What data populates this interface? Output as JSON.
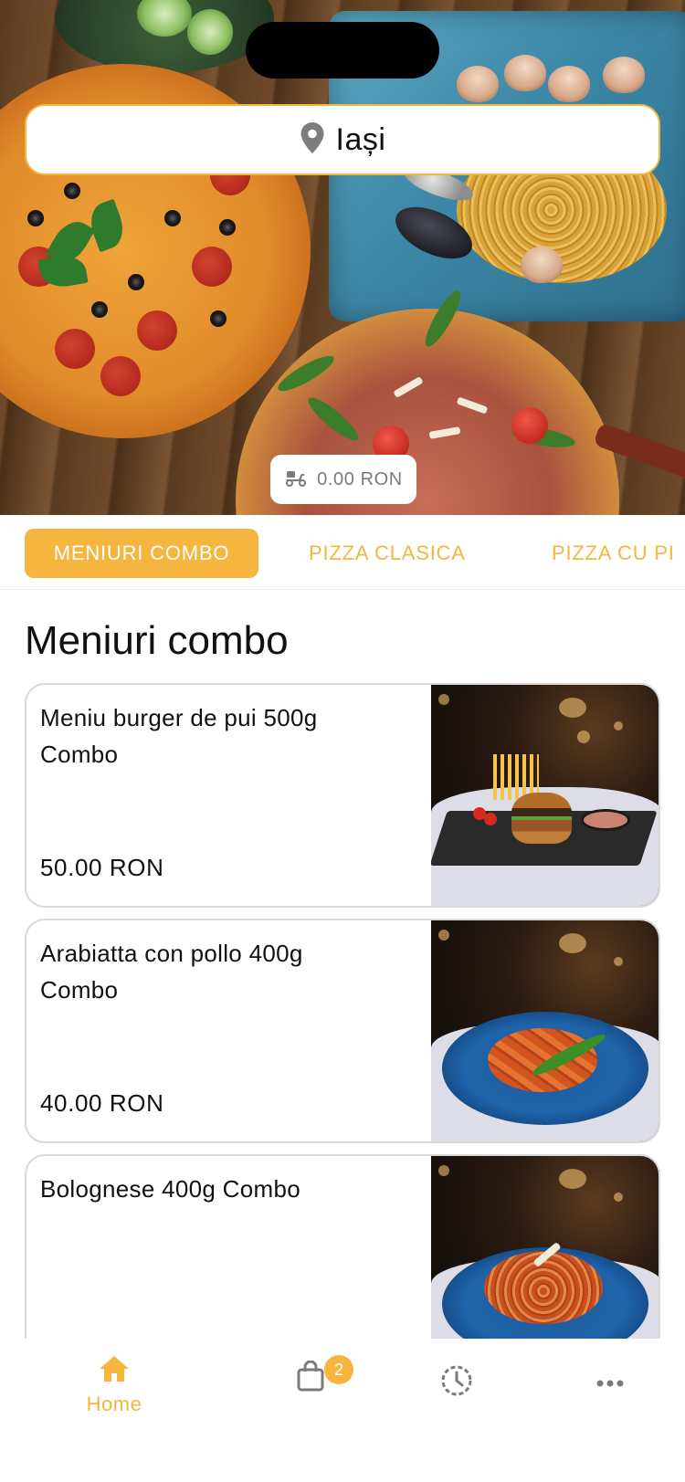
{
  "header": {
    "location": "Iași",
    "delivery_fee": "0.00 RON"
  },
  "categories": [
    {
      "label": "MENIURI COMBO",
      "active": true
    },
    {
      "label": "PIZZA CLASICA",
      "active": false
    },
    {
      "label": "PIZZA CU PI",
      "active": false
    }
  ],
  "section": {
    "title": "Meniuri combo"
  },
  "products": [
    {
      "name": "Meniu burger de pui 500g Combo",
      "price": "50.00 RON"
    },
    {
      "name": "Arabiatta con pollo 400g Combo",
      "price": "40.00 RON"
    },
    {
      "name": "Bolognese 400g Combo",
      "price": ""
    }
  ],
  "bottom_nav": {
    "home_label": "Home",
    "cart_count": "2"
  },
  "colors": {
    "accent": "#f6b53e",
    "text": "#111111",
    "muted": "#7a7a7a",
    "border": "#d9d9d9"
  },
  "icons": [
    "location-pin-icon",
    "delivery-scooter-icon",
    "home-icon",
    "shopping-bag-icon",
    "history-clock-icon",
    "more-dots-icon"
  ]
}
